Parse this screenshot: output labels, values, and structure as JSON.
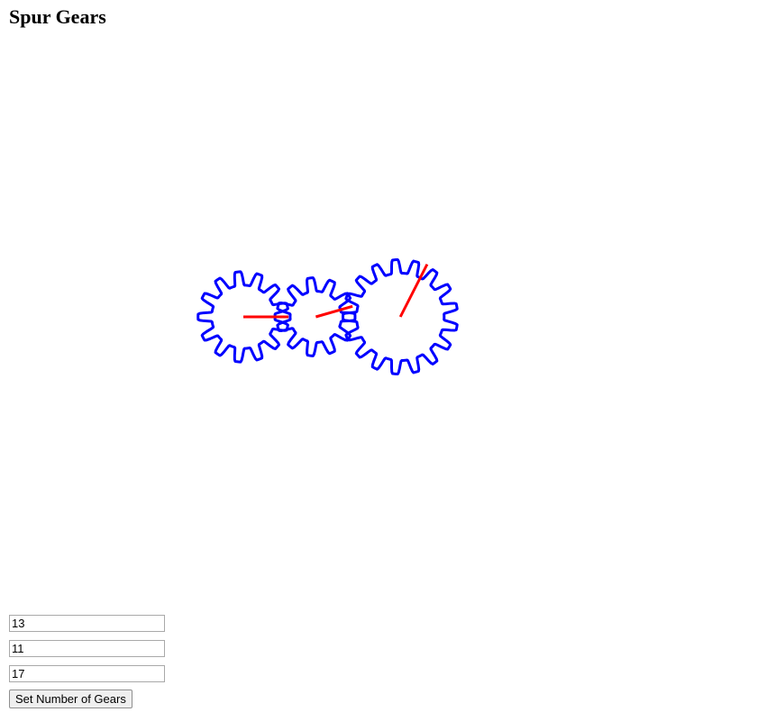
{
  "page": {
    "title": "Spur Gears"
  },
  "gears": {
    "teeth_counts": [
      "13",
      "11",
      "17"
    ],
    "gear_color": "#0000ff",
    "indicator_color": "#ff0000"
  },
  "controls": {
    "set_button_label": "Set Number of Gears"
  }
}
